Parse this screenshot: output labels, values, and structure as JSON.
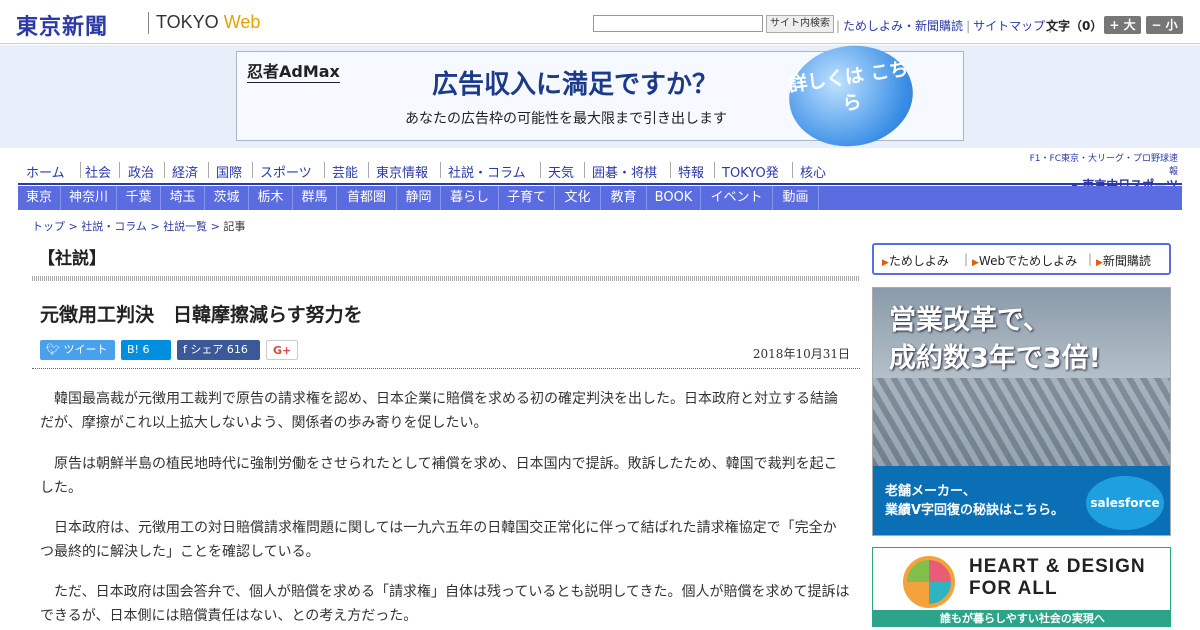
{
  "header": {
    "logo": "東京新聞",
    "sub_logo_a": "TOKYO ",
    "sub_logo_b": "Web",
    "search_placeholder": "",
    "search_button": "サイト内検索",
    "links": [
      "ためしよみ・新聞購読",
      "サイトマップ"
    ],
    "font_label": "文字（0）",
    "font_up": "+ 大",
    "font_down": "− 小"
  },
  "ad_top": {
    "brand": "忍者AdMax",
    "headline": "広告収入に満足ですか？",
    "sub": "あなたの広告枠の可能性を最大限まで引き出します",
    "cta": "詳しくは こちら"
  },
  "global_nav": [
    "ホーム",
    "社会",
    "政治",
    "経済",
    "国際",
    "スポーツ",
    "芸能",
    "東京情報",
    "社説・コラム",
    "天気",
    "囲碁・将棋",
    "特報",
    "TOKYO発",
    "核心"
  ],
  "chunichi": {
    "line1": "F1・FC東京・大リーグ・プロ野球速報",
    "line2": "▸ 東京中日スポーツ"
  },
  "local_nav": [
    "東京",
    "神奈川",
    "千葉",
    "埼玉",
    "茨城",
    "栃木",
    "群馬",
    "首都圏",
    "静岡",
    "暮らし",
    "子育て",
    "文化",
    "教育",
    "BOOK",
    "イベント",
    "動画"
  ],
  "breadcrumb": {
    "items": [
      "トップ",
      "社説・コラム",
      "社説一覧"
    ],
    "sep": " > ",
    "current": "記事"
  },
  "article": {
    "section": "【社説】",
    "title": "元徴用工判決　日韓摩擦減らす努力を",
    "date": "2018年10月31日",
    "share": {
      "tweet": "ツイート",
      "hatena": "B! 6",
      "facebook": "f シェア 616",
      "gplus": "G+"
    },
    "paragraphs": [
      "韓国最高裁が元徴用工裁判で原告の請求権を認め、日本企業に賠償を求める初の確定判決を出した。日本政府と対立する結論だが、摩擦がこれ以上拡大しないよう、関係者の歩み寄りを促したい。",
      "原告は朝鮮半島の植民地時代に強制労働をさせられたとして補償を求め、日本国内で提訴。敗訴したため、韓国で裁判を起こした。",
      "日本政府は、元徴用工の対日賠償請求権問題に関しては一九六五年の日韓国交正常化に伴って結ばれた請求権協定で「完全かつ最終的に解決した」ことを確認している。",
      "ただ、日本政府は国会答弁で、個人が賠償を求める「請求権」自体は残っているとも説明してきた。個人が賠償を求めて提訴はできるが、日本側には賠償責任はない、との考え方だった。"
    ]
  },
  "sidebar": {
    "links": [
      "ためしよみ",
      "Webでためしよみ",
      "新聞購読"
    ],
    "ad_sales": {
      "headline1": "営業改革で、",
      "headline2": "成約数3年で3倍!",
      "bottom1": "老舗メーカー、",
      "bottom2": "業績V字回復の秘訣はこちら。",
      "brand": "salesforce"
    },
    "ad_heart": {
      "title1": "HEART & DESIGN",
      "title2": "FOR ALL",
      "strip": "誰もが暮らしやすい社会の実現へ"
    }
  }
}
